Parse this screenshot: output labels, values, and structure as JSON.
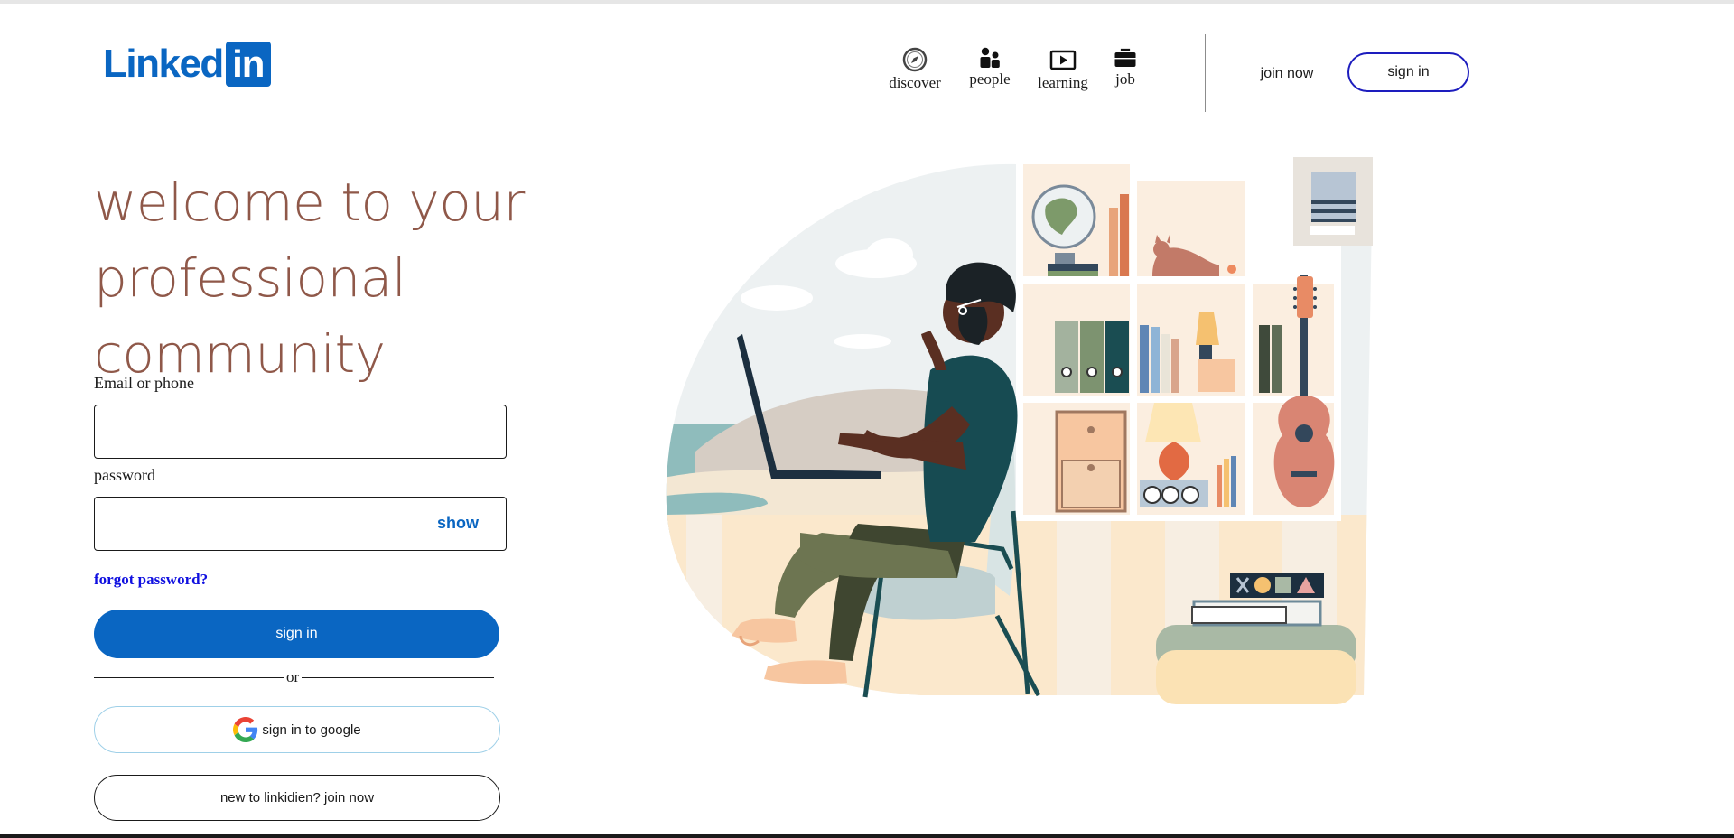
{
  "brand": {
    "word": "Linked",
    "box": "in",
    "color": "#0a66c2"
  },
  "nav": {
    "items": [
      {
        "label": "discover",
        "icon": "compass-icon"
      },
      {
        "label": "people",
        "icon": "people-icon"
      },
      {
        "label": "learning",
        "icon": "play-video-icon"
      },
      {
        "label": "job",
        "icon": "briefcase-icon"
      }
    ],
    "join_now": "join now",
    "sign_in": "sign in"
  },
  "hero": {
    "line1": "welcome to your",
    "line2": "professional community"
  },
  "form": {
    "email_label": "Email or phone",
    "email_value": "",
    "password_label": "password",
    "password_value": "",
    "show_label": "show",
    "forgot_label": "forgot password?",
    "signin_label": "sign in",
    "or_label": "or",
    "google_label": "sign in to google",
    "join_label": "new to linkidien? join now"
  },
  "colors": {
    "accent": "#0a66c2",
    "headline": "#8f5849",
    "link": "#1010e0"
  }
}
